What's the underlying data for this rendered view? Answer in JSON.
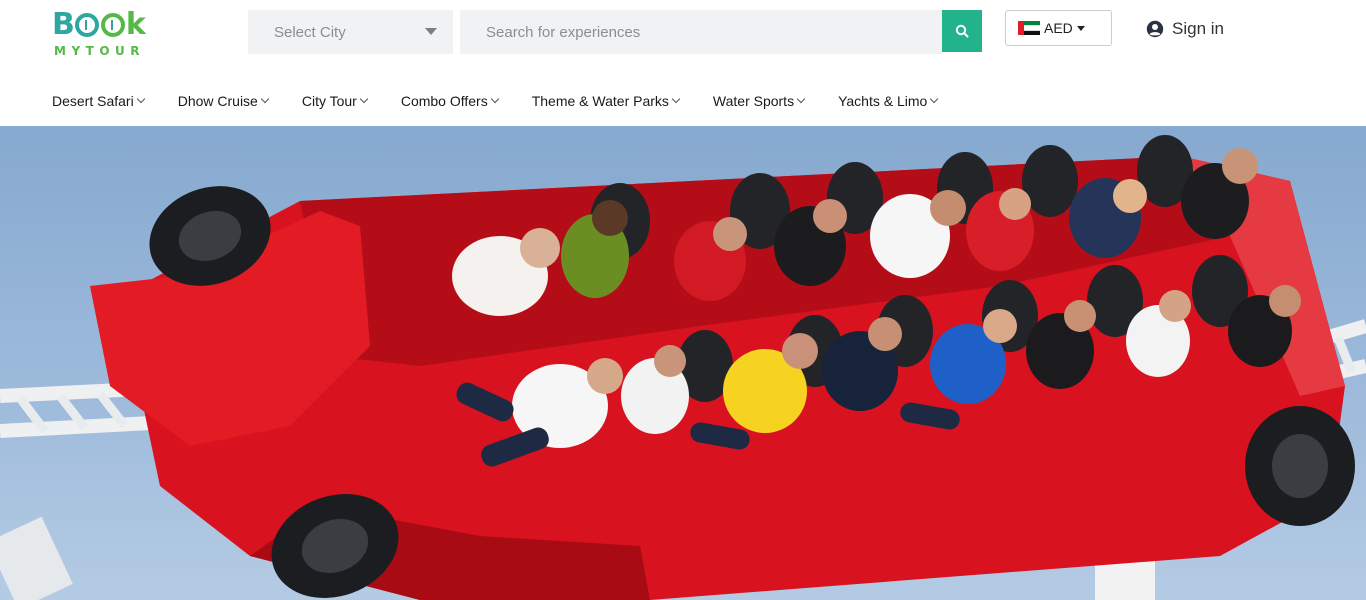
{
  "brand": {
    "logo_top": "BOOK",
    "logo_bottom": "MYTOUR"
  },
  "header": {
    "city_select": {
      "placeholder": "Select City"
    },
    "search": {
      "placeholder": "Search for experiences"
    },
    "currency": {
      "code": "AED"
    },
    "signin_label": "Sign in",
    "accent_color": "#23b38c"
  },
  "nav": {
    "items": [
      {
        "label": "Desert Safari"
      },
      {
        "label": "Dhow Cruise"
      },
      {
        "label": "City Tour"
      },
      {
        "label": "Combo Offers"
      },
      {
        "label": "Theme & Water Parks"
      },
      {
        "label": "Water Sports"
      },
      {
        "label": "Yachts & Limo"
      }
    ]
  },
  "hero": {
    "icon": "roller-coaster-photo"
  }
}
